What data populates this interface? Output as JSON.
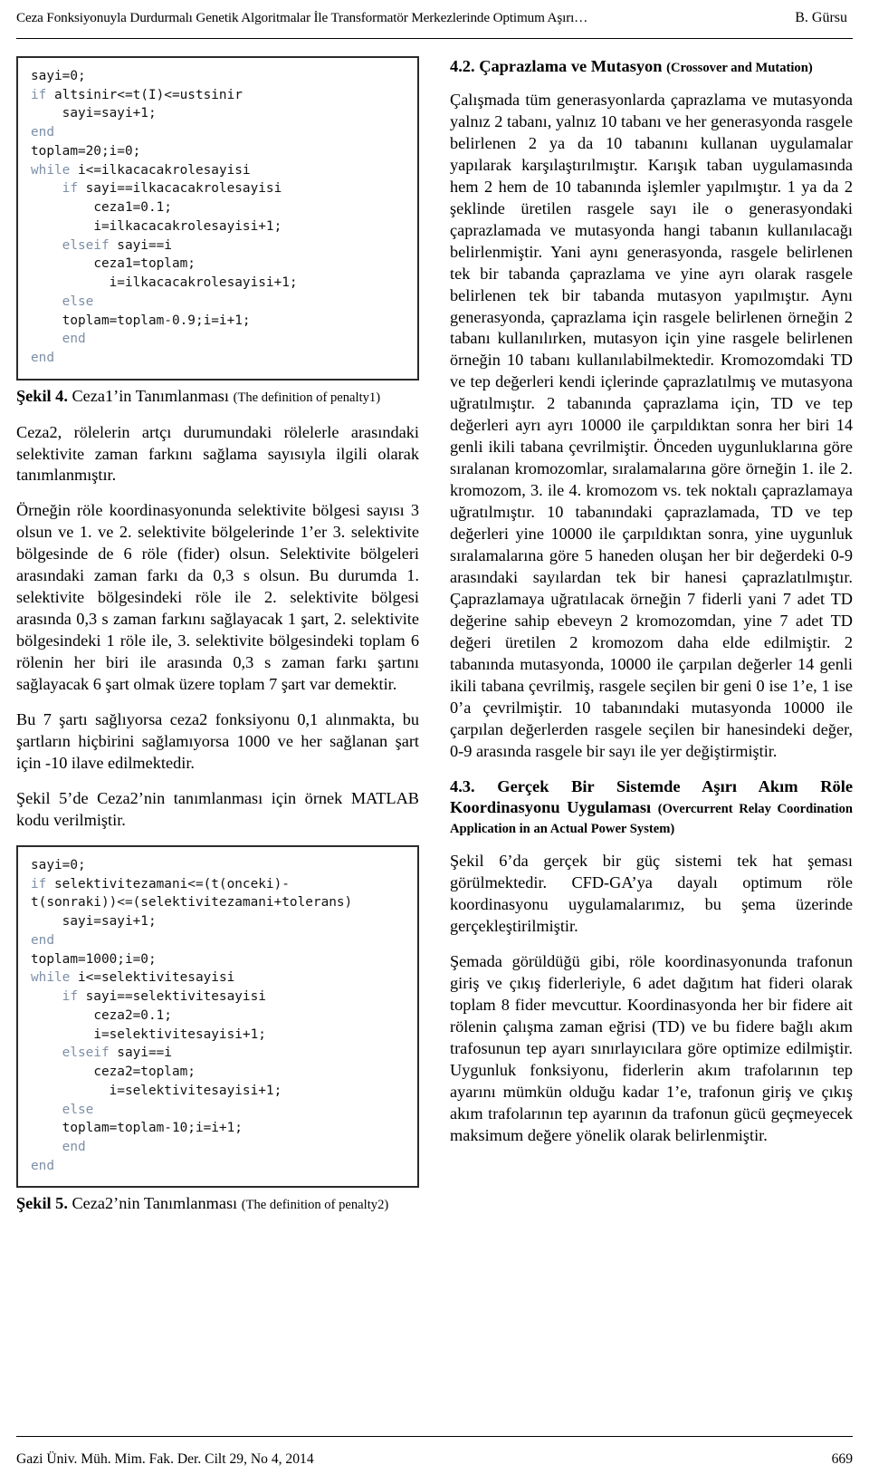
{
  "running_head": {
    "left": "Ceza Fonksiyonuyla Durdurmalı Genetik Algoritmalar İle Transformatör Merkezlerinde Optimum Aşırı…",
    "right": "B. Gürsu"
  },
  "left_column": {
    "code_block_1": "sayi=0;\nif altsinir<=t(I)<=ustsinir\n    sayi=sayi+1;\nend\ntoplam=20;i=0;\nwhile i<=ilkacacakrolesayisi\n    if sayi==ilkacacakrolesayisi\n        ceza1=0.1;\n        i=ilkacacakrolesayisi+1;\n    elseif sayi==i\n        ceza1=toplam;\n          i=ilkacacakrolesayisi+1;\n    else\n    toplam=toplam-0.9;i=i+1;\n    end\nend",
    "figure_4": {
      "label": "Şekil 4.",
      "title": "Ceza1’in Tanımlanması",
      "english": "(The definition of penalty1)"
    },
    "para_1": "Ceza2, rölelerin artçı durumundaki rölelerle arasındaki selektivite zaman farkını sağlama sayısıyla ilgili olarak tanımlanmıştır.",
    "para_2": "Örneğin röle koordinasyonunda selektivite bölgesi sayısı 3 olsun ve 1. ve 2. selektivite bölgelerinde 1’er 3. selektivite bölgesinde de 6 röle (fider) olsun. Selektivite bölgeleri arasındaki zaman farkı da 0,3 s olsun. Bu durumda 1. selektivite bölgesindeki röle ile 2. selektivite bölgesi arasında 0,3 s zaman farkını sağlayacak 1 şart, 2. selektivite bölgesindeki 1 röle ile, 3. selektivite bölgesindeki toplam 6 rölenin her biri ile arasında 0,3 s zaman farkı şartını sağlayacak 6 şart olmak üzere toplam 7 şart var demektir.",
    "para_3": "Bu 7 şartı sağlıyorsa ceza2 fonksiyonu 0,1 alınmakta, bu şartların hiçbirini sağlamıyorsa 1000 ve her sağlanan şart için -10 ilave edilmektedir.",
    "para_4": "Şekil 5’de Ceza2’nin tanımlanması için örnek MATLAB kodu verilmiştir.",
    "code_block_2": "sayi=0;\nif selektivitezamani<=(t(onceki)-\nt(sonraki))<=(selektivitezamani+tolerans)\n    sayi=sayi+1;\nend\ntoplam=1000;i=0;\nwhile i<=selektivitesayisi\n    if sayi==selektivitesayisi\n        ceza2=0.1;\n        i=selektivitesayisi+1;\n    elseif sayi==i\n        ceza2=toplam;\n          i=selektivitesayisi+1;\n    else\n    toplam=toplam-10;i=i+1;\n    end\nend",
    "figure_5": {
      "label": "Şekil 5.",
      "title": "Ceza2’nin Tanımlanması",
      "english": "(The definition of penalty2)"
    }
  },
  "right_column": {
    "heading_42": {
      "num": "4.2.",
      "title": "Çaprazlama ve Mutasyon",
      "english": "(Crossover and Mutation)"
    },
    "para_1": "Çalışmada tüm generasyonlarda çaprazlama ve mutasyonda yalnız 2 tabanı, yalnız 10 tabanı ve her generasyonda rasgele belirlenen 2 ya da 10 tabanını kullanan uygulamalar yapılarak karşılaştırılmıştır. Karışık taban uygulamasında hem 2 hem de 10 tabanında işlemler yapılmıştır. 1 ya da 2 şeklinde üretilen rasgele sayı ile o generasyondaki çaprazlamada ve mutasyonda hangi tabanın kullanılacağı belirlenmiştir. Yani aynı generasyonda, rasgele belirlenen tek bir tabanda çaprazlama ve yine ayrı olarak rasgele belirlenen tek bir tabanda mutasyon yapılmıştır. Aynı generasyonda, çaprazlama için rasgele belirlenen örneğin 2 tabanı kullanılırken, mutasyon için yine rasgele belirlenen örneğin 10 tabanı kullanılabilmektedir. Kromozomdaki TD ve tep değerleri kendi içlerinde çaprazlatılmış ve mutasyona uğratılmıştır. 2 tabanında çaprazlama için, TD ve tep değerleri ayrı ayrı 10000 ile çarpıldıktan sonra her biri 14 genli ikili tabana çevrilmiştir. Önceden uygunluklarına göre sıralanan kromozomlar, sıralamalarına göre örneğin 1. ile 2. kromozom, 3. ile 4. kromozom vs. tek noktalı çaprazlamaya uğratılmıştır. 10 tabanındaki çaprazlamada, TD ve tep değerleri yine 10000 ile çarpıldıktan sonra, yine uygunluk sıralamalarına göre 5 haneden oluşan her bir değerdeki 0-9 arasındaki sayılardan tek bir hanesi çaprazlatılmıştır. Çaprazlamaya uğratılacak örneğin 7 fiderli yani 7 adet TD değerine sahip ebeveyn 2 kromozomdan, yine 7 adet TD değeri üretilen 2 kromozom daha elde edilmiştir. 2 tabanında mutasyonda, 10000 ile çarpılan değerler 14 genli ikili tabana çevrilmiş, rasgele seçilen bir geni 0 ise 1’e, 1 ise 0’a çevrilmiştir. 10 tabanındaki mutasyonda 10000 ile çarpılan değerlerden rasgele seçilen bir hanesindeki değer, 0-9 arasında rasgele bir sayı ile yer değiştirmiştir.",
    "heading_43": {
      "num": "4.3.",
      "title": "Gerçek Bir Sistemde Aşırı Akım Röle Koordinasyonu Uygulaması",
      "english": "(Overcurrent Relay Coordination Application in an Actual Power System)"
    },
    "para_2": "Şekil 6’da gerçek bir güç sistemi tek hat şeması görülmektedir. CFD-GA’ya dayalı optimum röle koordinasyonu uygulamalarımız, bu şema üzerinde gerçekleştirilmiştir.",
    "para_3": "Şemada görüldüğü gibi, röle koordinasyonunda trafonun giriş ve çıkış fiderleriyle, 6 adet dağıtım hat fideri olarak toplam 8 fider mevcuttur. Koordinasyonda her bir fidere ait rölenin çalışma zaman eğrisi (TD) ve bu fidere bağlı akım trafosunun tep ayarı sınırlayıcılara göre optimize edilmiştir. Uygunluk fonksiyonu, fiderlerin akım trafolarının tep ayarını mümkün olduğu kadar 1’e, trafonun giriş ve çıkış akım trafolarının tep ayarının da trafonun gücü geçmeyecek maksimum değere yönelik olarak belirlenmiştir."
  },
  "footer": {
    "left": "Gazi Üniv. Müh. Mim. Fak. Der. Cilt 29, No 4, 2014",
    "right": "669"
  }
}
